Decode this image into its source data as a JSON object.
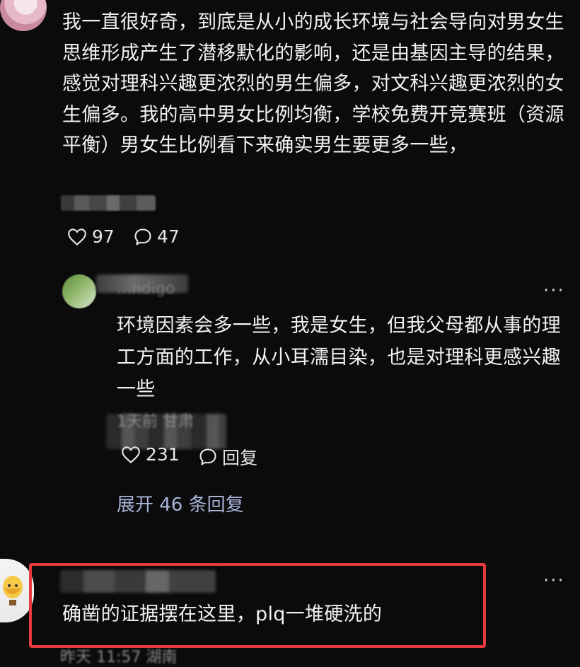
{
  "comment": {
    "text": "我一直很好奇，到底是从小的成长环境与社会导向对男女生思维形成产生了潜移默化的影响，还是由基因主导的结果，感觉对理科兴趣更浓烈的男生偏多，对文科兴趣更浓烈的女生偏多。我的高中男女比例均衡，学校免费开竞赛班（资源平衡）男女生比例看下来确实男生要更多一些，",
    "likes": "97",
    "replies": "47"
  },
  "reply": {
    "username": "...ndigo",
    "text": "环境因素会多一些，我是女生，但我父母都从事的理工方面的工作，从小耳濡目染，也是对理科更感兴趣一些",
    "meta": "1天前 甘肃",
    "likes": "231",
    "reply_label": "回复",
    "more": "···"
  },
  "expand_replies": "展开 46 条回复",
  "bottom_comment": {
    "text": "确凿的证据摆在这里，plq一堆硬洗的",
    "meta": "昨天 11:57 湖南",
    "more": "···"
  },
  "icons": {
    "like": "heart-outline-icon",
    "reply": "speech-bubble-icon",
    "more": "ellipsis-icon"
  },
  "colors": {
    "background": "#0b0b0c",
    "text": "#f2f2f2",
    "link": "#a8b3d6",
    "highlight": "#e8393b"
  }
}
